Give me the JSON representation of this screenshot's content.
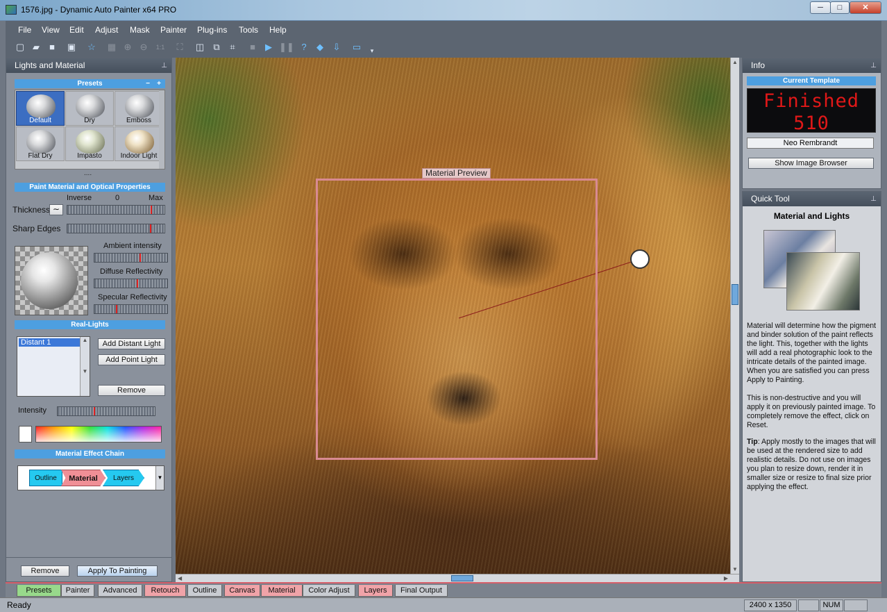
{
  "window": {
    "title": "1576.jpg - Dynamic Auto Painter x64 PRO",
    "minimize": "─",
    "maximize": "□",
    "close": "✕"
  },
  "menu": [
    "File",
    "View",
    "Edit",
    "Adjust",
    "Mask",
    "Painter",
    "Plug-ins",
    "Tools",
    "Help"
  ],
  "toolbar_icons": [
    "new-icon",
    "open-icon",
    "save-icon",
    "save-as-icon",
    "favorite-icon",
    "photo-icon",
    "zoom-in-icon",
    "zoom-out-icon",
    "zoom-1to1-icon",
    "fit-icon",
    "layout-icon",
    "compare-icon",
    "crop-icon",
    "stop-icon",
    "play-icon",
    "pause-icon",
    "help-icon",
    "eraser-icon",
    "download-icon",
    "frame-icon",
    "dropdown-icon"
  ],
  "toolbar_zoom_label": "1:1",
  "left_panel": {
    "title": "Lights and Material",
    "pin": "⊥",
    "presets_header": "Presets",
    "presets_minus": "−",
    "presets_plus": "+",
    "presets": [
      "Default",
      "Dry",
      "Emboss",
      "Flat Dry",
      "Impasto",
      "Indoor Light"
    ],
    "more_dots": "....",
    "paint_header": "Paint Material and Optical Properties",
    "scale_inverse": "Inverse",
    "scale_zero": "0",
    "scale_max": "Max",
    "thickness_label": "Thickness",
    "thickness_curve": "∼",
    "sharp_edges_label": "Sharp Edges",
    "ambient_label": "Ambient intensity",
    "diffuse_label": "Diffuse Reflectivity",
    "specular_label": "Specular Reflectivity",
    "reallights_header": "Real-Lights",
    "lights": [
      "Distant 1"
    ],
    "add_distant": "Add Distant Light",
    "add_point": "Add Point Light",
    "remove_light": "Remove",
    "intensity_label": "Intensity",
    "chain_header": "Material Effect Chain",
    "chain": [
      "Outline",
      "Material",
      "Layers"
    ],
    "remove_btn": "Remove",
    "apply_btn": "Apply To Painting",
    "sliders": {
      "thickness": 0.87,
      "sharp_edges": 0.86,
      "ambient": 0.63,
      "diffuse": 0.59,
      "specular": 0.3,
      "intensity": 0.38
    }
  },
  "canvas": {
    "preview_label": "Material Preview"
  },
  "info_panel": {
    "title": "Info",
    "template_header": "Current Template",
    "led_line1": "Finished",
    "led_line2": "510",
    "template_name": "Neo Rembrandt",
    "show_browser": "Show Image Browser"
  },
  "quick_panel": {
    "title": "Quick Tool",
    "heading": "Material and Lights",
    "para1": "Material will determine how the pigment and binder solution of the paint reflects the light. This, together with the lights will add a real photographic look to the intricate details of the painted image. When you are satisfied you can press Apply to Painting.",
    "para2": "This is non-destructive and you will apply it on previously painted image. To completely remove the effect, click on Reset.",
    "tip_label": "Tip",
    "tip_text": ": Apply mostly to the images that will be used at the rendered size to add realistic details. Do not use on images you plan to resize down, render it in smaller size or resize to final size prior applying the effect."
  },
  "tabs": [
    "Presets",
    "Painter",
    "Advanced",
    "Retouch",
    "Outline",
    "Canvas",
    "Material",
    "Color Adjust",
    "Layers",
    "Final Output"
  ],
  "status": {
    "text": "Ready",
    "dimensions": "2400 x 1350",
    "num": "NUM"
  }
}
